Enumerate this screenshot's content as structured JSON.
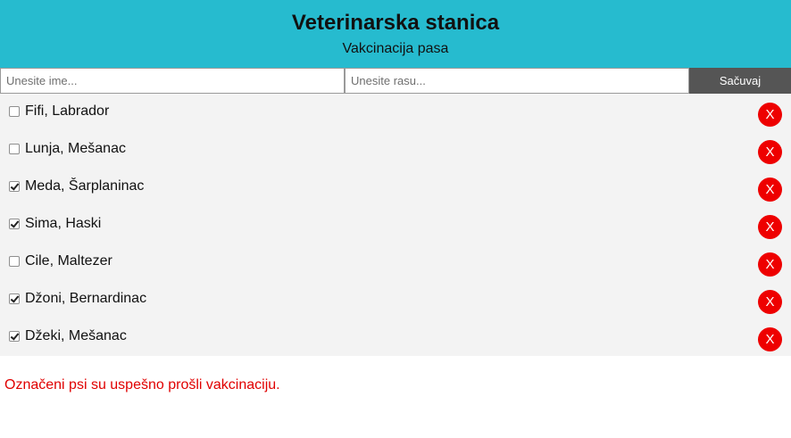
{
  "header": {
    "title": "Veterinarska stanica",
    "subtitle": "Vakcinacija pasa"
  },
  "form": {
    "name_placeholder": "Unesite ime...",
    "breed_placeholder": "Unesite rasu...",
    "save_label": "Sačuvaj"
  },
  "dogs": [
    {
      "label": "Fifi, Labrador",
      "checked": false,
      "delete_label": "X"
    },
    {
      "label": "Lunja, Mešanac",
      "checked": false,
      "delete_label": "X"
    },
    {
      "label": "Meda, Šarplaninac",
      "checked": true,
      "delete_label": "X"
    },
    {
      "label": "Sima, Haski",
      "checked": true,
      "delete_label": "X"
    },
    {
      "label": "Cile, Maltezer",
      "checked": false,
      "delete_label": "X"
    },
    {
      "label": "Džoni, Bernardinac",
      "checked": true,
      "delete_label": "X"
    },
    {
      "label": "Džeki, Mešanac",
      "checked": true,
      "delete_label": "X"
    }
  ],
  "message": "Označeni psi su uspešno prošli vakcinaciju.",
  "colors": {
    "header_bg": "#26bbcf",
    "list_bg": "#f3f3f3",
    "save_button_bg": "#555555",
    "delete_button_bg": "#ee0000",
    "message_text": "#e00000"
  }
}
